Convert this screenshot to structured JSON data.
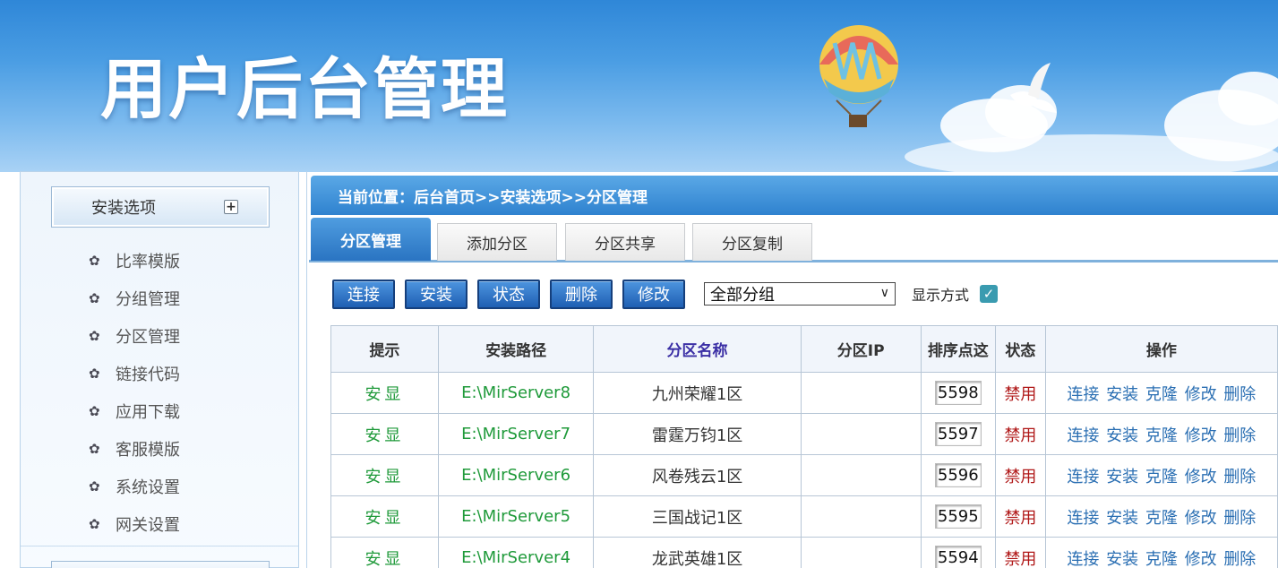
{
  "header": {
    "title": "用户后台管理"
  },
  "sidebar": {
    "section_title": "安装选项",
    "toggle_symbol": "+",
    "items": [
      {
        "label": "比率模版"
      },
      {
        "label": "分组管理"
      },
      {
        "label": "分区管理"
      },
      {
        "label": "链接代码"
      },
      {
        "label": "应用下载"
      },
      {
        "label": "客服模版"
      },
      {
        "label": "系统设置"
      },
      {
        "label": "网关设置"
      }
    ]
  },
  "breadcrumb": {
    "text": "当前位置：后台首页>>安装选项>>分区管理"
  },
  "tabs": [
    {
      "label": "分区管理",
      "active": true
    },
    {
      "label": "添加分区",
      "active": false
    },
    {
      "label": "分区共享",
      "active": false
    },
    {
      "label": "分区复制",
      "active": false
    }
  ],
  "toolbar": {
    "buttons": [
      "连接",
      "安装",
      "状态",
      "删除",
      "修改"
    ],
    "group_select": {
      "value": "全部分组"
    },
    "display_mode_label": "显示方式",
    "display_mode_checked": true
  },
  "table": {
    "columns": [
      "提示",
      "安装路径",
      "分区名称",
      "分区IP",
      "排序点这",
      "状态",
      "操作"
    ],
    "rows": [
      {
        "tip": "安显",
        "path": "E:\\MirServer8",
        "name": "九州荣耀1区",
        "ip": "",
        "order": "5598",
        "status": "禁用"
      },
      {
        "tip": "安显",
        "path": "E:\\MirServer7",
        "name": "雷霆万钧1区",
        "ip": "",
        "order": "5597",
        "status": "禁用"
      },
      {
        "tip": "安显",
        "path": "E:\\MirServer6",
        "name": "风卷残云1区",
        "ip": "",
        "order": "5596",
        "status": "禁用"
      },
      {
        "tip": "安显",
        "path": "E:\\MirServer5",
        "name": "三国战记1区",
        "ip": "",
        "order": "5595",
        "status": "禁用"
      },
      {
        "tip": "安显",
        "path": "E:\\MirServer4",
        "name": "龙武英雄1区",
        "ip": "",
        "order": "5594",
        "status": "禁用"
      }
    ],
    "row_actions": [
      "连接",
      "安装",
      "克隆",
      "修改",
      "删除"
    ]
  },
  "colors": {
    "header_blue": "#2f87d8",
    "button_blue": "#1f5fb3",
    "tip_green": "#1f9a3a",
    "status_red": "#b01818",
    "link_blue": "#2b6fb3"
  }
}
